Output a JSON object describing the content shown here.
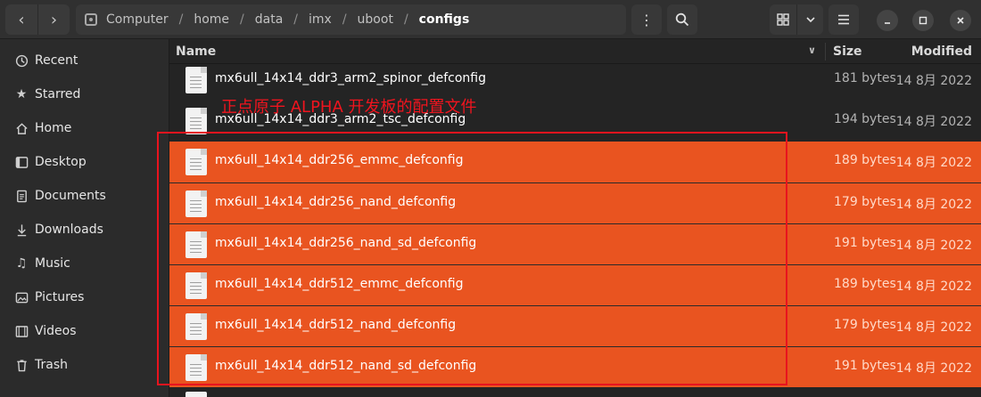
{
  "header": {
    "back_icon": "chevron-left-icon",
    "forward_icon": "chevron-right-icon",
    "path": [
      "Computer",
      "home",
      "data",
      "imx",
      "uboot",
      "configs"
    ]
  },
  "sidebar": {
    "items": [
      {
        "label": "Recent",
        "icon": "clock-icon"
      },
      {
        "label": "Starred",
        "icon": "star-icon"
      },
      {
        "label": "Home",
        "icon": "home-icon"
      },
      {
        "label": "Desktop",
        "icon": "desktop-icon"
      },
      {
        "label": "Documents",
        "icon": "document-icon"
      },
      {
        "label": "Downloads",
        "icon": "download-icon"
      },
      {
        "label": "Music",
        "icon": "music-icon"
      },
      {
        "label": "Pictures",
        "icon": "pictures-icon"
      },
      {
        "label": "Videos",
        "icon": "video-icon"
      },
      {
        "label": "Trash",
        "icon": "trash-icon"
      }
    ]
  },
  "columns": {
    "name": "Name",
    "size": "Size",
    "modified": "Modified"
  },
  "files": [
    {
      "name": "mx6ull_14x14_ddr3_arm2_spinor_defconfig",
      "size": "181 bytes",
      "modified": "14 8月 2022",
      "selected": false
    },
    {
      "name": "mx6ull_14x14_ddr3_arm2_tsc_defconfig",
      "size": "194 bytes",
      "modified": "14 8月 2022",
      "selected": false
    },
    {
      "name": "mx6ull_14x14_ddr256_emmc_defconfig",
      "size": "189 bytes",
      "modified": "14 8月 2022",
      "selected": true
    },
    {
      "name": "mx6ull_14x14_ddr256_nand_defconfig",
      "size": "179 bytes",
      "modified": "14 8月 2022",
      "selected": true
    },
    {
      "name": "mx6ull_14x14_ddr256_nand_sd_defconfig",
      "size": "191 bytes",
      "modified": "14 8月 2022",
      "selected": true
    },
    {
      "name": "mx6ull_14x14_ddr512_emmc_defconfig",
      "size": "189 bytes",
      "modified": "14 8月 2022",
      "selected": true
    },
    {
      "name": "mx6ull_14x14_ddr512_nand_defconfig",
      "size": "179 bytes",
      "modified": "14 8月 2022",
      "selected": true
    },
    {
      "name": "mx6ull_14x14_ddr512_nand_sd_defconfig",
      "size": "191 bytes",
      "modified": "14 8月 2022",
      "selected": true
    }
  ],
  "annotation": {
    "text": "正点原子 ALPHA 开发板的配置文件",
    "color": "#e8141e"
  },
  "colors": {
    "accent": "#e95420",
    "background": "#242424",
    "sidebar": "#2b2b2b"
  }
}
